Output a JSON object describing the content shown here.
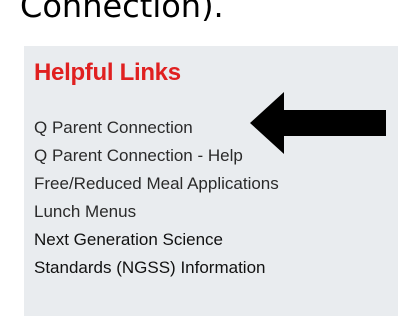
{
  "page": {
    "cut_text": "Connection)."
  },
  "helpful_links": {
    "heading": "Helpful Links",
    "items": [
      {
        "label": "Q Parent Connection"
      },
      {
        "label": "Q Parent Connection - Help"
      },
      {
        "label": "Free/Reduced Meal Applications"
      },
      {
        "label": "Lunch Menus"
      },
      {
        "label": "Next Generation Science"
      },
      {
        "label": "Standards (NGSS) Information"
      }
    ]
  },
  "annotation": {
    "icon": "arrow-left-icon",
    "color": "#000000"
  },
  "colors": {
    "heading": "#e02020",
    "panel_bg": "#e9ecef",
    "link_text": "#2a2a2a"
  }
}
